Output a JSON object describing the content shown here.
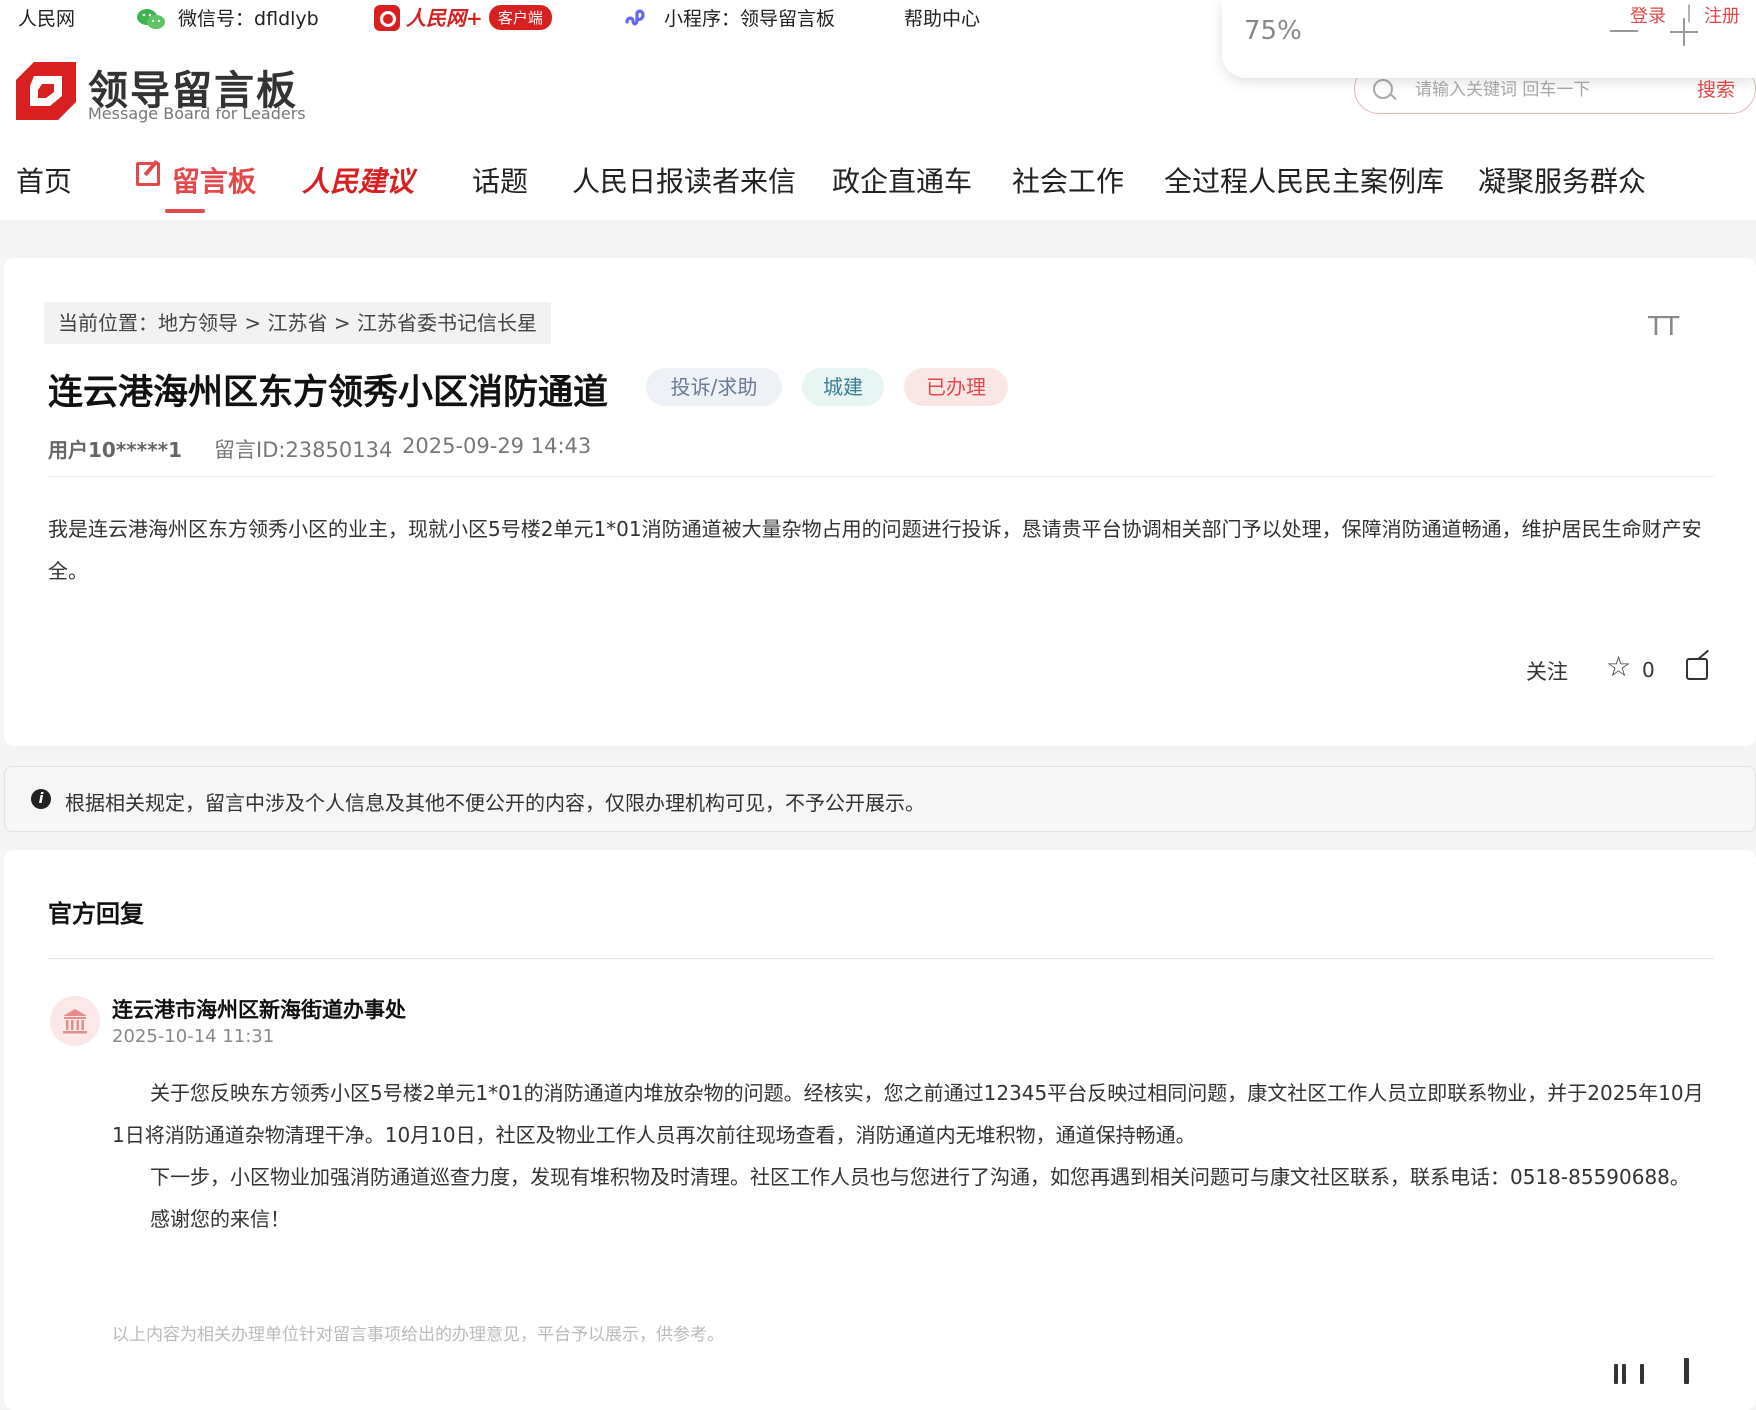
{
  "topbar": {
    "people_net": "人民网",
    "wechat": "微信号：dfldlyb",
    "app_brand": "人民网+",
    "app_badge": "客户端",
    "mini_program": "小程序：领导留言板",
    "help_center": "帮助中心"
  },
  "zoom": {
    "level": "75%"
  },
  "auth": {
    "login": "登录",
    "separator": "|",
    "register": "注册"
  },
  "search": {
    "placeholder": "请输入关键词 回车一下",
    "button": "搜索"
  },
  "logo": {
    "cn": "领导留言板",
    "en": "Message Board for Leaders"
  },
  "nav": {
    "home": "首页",
    "message_board": "留言板",
    "suggestion": "人民建议",
    "topic": "话题",
    "readers_letters": "人民日报读者来信",
    "gov_enterprise": "政企直通车",
    "social_work": "社会工作",
    "democracy_cases": "全过程人民民主案例库",
    "serve_masses": "凝聚服务群众"
  },
  "breadcrumb": "当前位置：地方领导 > 江苏省 > 江苏省委书记信长星",
  "font_size_label": "TT",
  "message": {
    "title": "连云港海州区东方领秀小区消防通道",
    "tags": [
      "投诉/求助",
      "城建",
      "已办理"
    ],
    "user": "用户10*****1",
    "id_text": "留言ID:23850134",
    "time": "2025-09-29 14:43",
    "content": "我是连云港海州区东方领秀小区的业主，现就小区5号楼2单元1*01消防通道被大量杂物占用的问题进行投诉，恳请贵平台协调相关部门予以处理，保障消防通道畅通，维护居民生命财产安全。",
    "follow": "关注",
    "star_count": "0"
  },
  "notice": "根据相关规定，留言中涉及个人信息及其他不便公开的内容，仅限办理机构可见，不予公开展示。",
  "reply": {
    "heading": "官方回复",
    "org": "连云港市海州区新海街道办事处",
    "time": "2025-10-14 11:31",
    "paragraphs": [
      "关于您反映东方领秀小区5号楼2单元1*01的消防通道内堆放杂物的问题。经核实，您之前通过12345平台反映过相同问题，康文社区工作人员立即联系物业，并于2025年10月1日将消防通道杂物清理干净。10月10日，社区及物业工作人员再次前往现场查看，消防通道内无堆积物，通道保持畅通。",
      "下一步，小区物业加强消防通道巡查力度，发现有堆积物及时清理。社区工作人员也与您进行了沟通，如您再遇到相关问题可与康文社区联系，联系电话：0518-85590688。",
      "感谢您的来信！"
    ],
    "disclaimer": "以上内容为相关办理单位针对留言事项给出的办理意见，平台予以展示，供参考。"
  }
}
